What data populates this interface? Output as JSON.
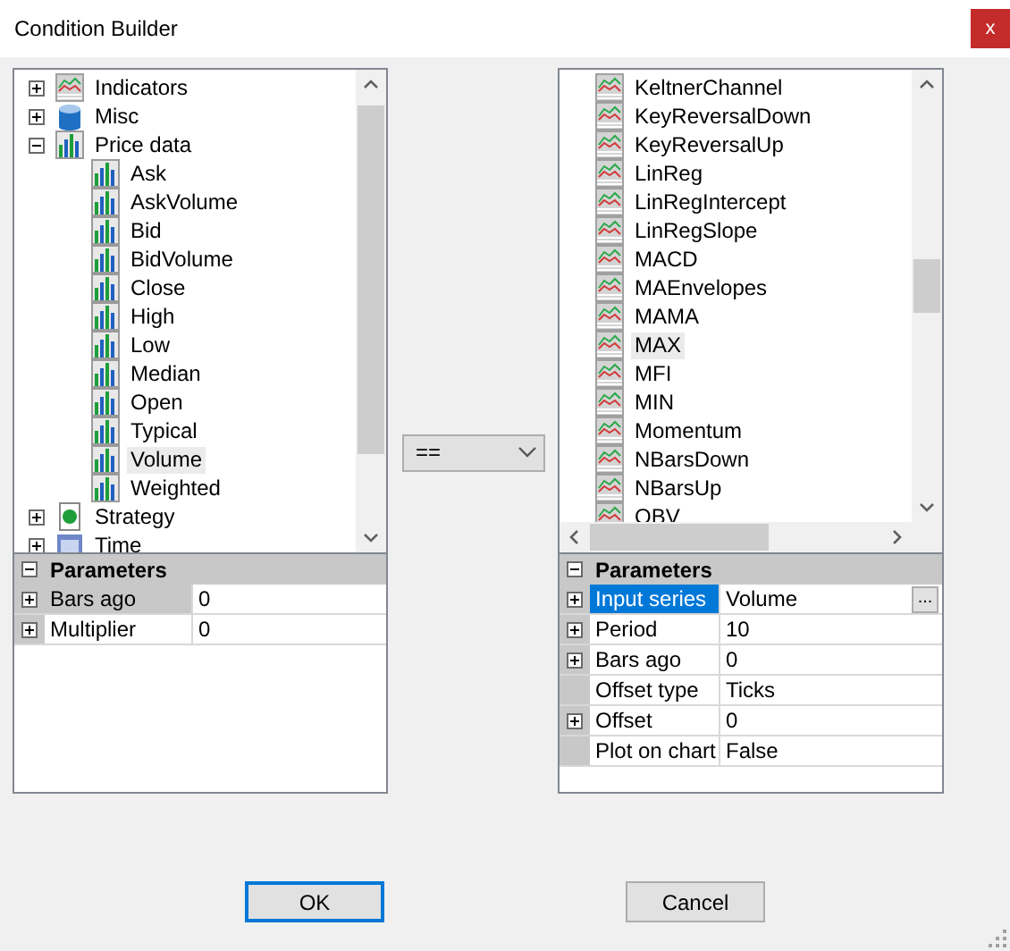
{
  "window": {
    "title": "Condition Builder",
    "close": "x"
  },
  "left": {
    "tree": [
      {
        "label": "Indicators",
        "kind": "indicator",
        "expanded": false,
        "selected": false
      },
      {
        "label": "Misc",
        "kind": "misc",
        "expanded": false,
        "selected": false
      },
      {
        "label": "Price data",
        "kind": "price",
        "expanded": true,
        "selected": false,
        "children": [
          {
            "label": "Ask",
            "kind": "price",
            "selected": false
          },
          {
            "label": "AskVolume",
            "kind": "price",
            "selected": false
          },
          {
            "label": "Bid",
            "kind": "price",
            "selected": false
          },
          {
            "label": "BidVolume",
            "kind": "price",
            "selected": false
          },
          {
            "label": "Close",
            "kind": "price",
            "selected": false
          },
          {
            "label": "High",
            "kind": "price",
            "selected": false
          },
          {
            "label": "Low",
            "kind": "price",
            "selected": false
          },
          {
            "label": "Median",
            "kind": "price",
            "selected": false
          },
          {
            "label": "Open",
            "kind": "price",
            "selected": false
          },
          {
            "label": "Typical",
            "kind": "price",
            "selected": false
          },
          {
            "label": "Volume",
            "kind": "price",
            "selected": true
          },
          {
            "label": "Weighted",
            "kind": "price",
            "selected": false
          }
        ]
      },
      {
        "label": "Strategy",
        "kind": "strategy",
        "expanded": false,
        "selected": false
      },
      {
        "label": "Time",
        "kind": "time",
        "expanded": false,
        "selected": false
      }
    ],
    "parameters": {
      "title": "Parameters",
      "expanded": true,
      "focused": false,
      "rows": [
        {
          "name": "Bars ago",
          "value": "0",
          "expandable": true,
          "selected": true
        },
        {
          "name": "Multiplier",
          "value": "0",
          "expandable": true,
          "selected": false
        }
      ]
    }
  },
  "operator": {
    "value": "=="
  },
  "right": {
    "tree": [
      {
        "label": "KeltnerChannel",
        "kind": "indicator",
        "selected": false
      },
      {
        "label": "KeyReversalDown",
        "kind": "indicator",
        "selected": false
      },
      {
        "label": "KeyReversalUp",
        "kind": "indicator",
        "selected": false
      },
      {
        "label": "LinReg",
        "kind": "indicator",
        "selected": false
      },
      {
        "label": "LinRegIntercept",
        "kind": "indicator",
        "selected": false
      },
      {
        "label": "LinRegSlope",
        "kind": "indicator",
        "selected": false
      },
      {
        "label": "MACD",
        "kind": "indicator",
        "selected": false
      },
      {
        "label": "MAEnvelopes",
        "kind": "indicator",
        "selected": false
      },
      {
        "label": "MAMA",
        "kind": "indicator",
        "selected": false
      },
      {
        "label": "MAX",
        "kind": "indicator",
        "selected": true
      },
      {
        "label": "MFI",
        "kind": "indicator",
        "selected": false
      },
      {
        "label": "MIN",
        "kind": "indicator",
        "selected": false
      },
      {
        "label": "Momentum",
        "kind": "indicator",
        "selected": false
      },
      {
        "label": "NBarsDown",
        "kind": "indicator",
        "selected": false
      },
      {
        "label": "NBarsUp",
        "kind": "indicator",
        "selected": false
      },
      {
        "label": "OBV",
        "kind": "indicator",
        "selected": false
      }
    ],
    "parameters": {
      "title": "Parameters",
      "expanded": true,
      "focused": true,
      "rows": [
        {
          "name": "Input series",
          "value": "Volume",
          "expandable": true,
          "selected": true,
          "button": "..."
        },
        {
          "name": "Period",
          "value": "10",
          "expandable": true,
          "selected": false
        },
        {
          "name": "Bars ago",
          "value": "0",
          "expandable": true,
          "selected": false
        },
        {
          "name": "Offset type",
          "value": "Ticks",
          "expandable": false,
          "selected": false
        },
        {
          "name": "Offset",
          "value": "0",
          "expandable": true,
          "selected": false
        },
        {
          "name": "Plot on chart",
          "value": "False",
          "expandable": false,
          "selected": false
        }
      ]
    }
  },
  "buttons": [
    {
      "label": "OK",
      "default": true
    },
    {
      "label": "Cancel",
      "default": false
    }
  ]
}
